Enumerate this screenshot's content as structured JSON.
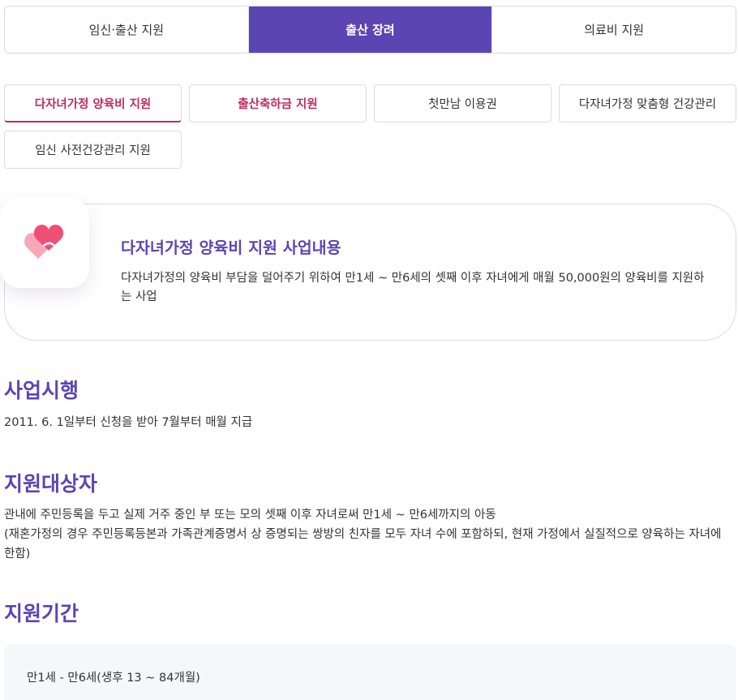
{
  "top_tabs": [
    {
      "label": "임신·출산 지원"
    },
    {
      "label": "출산 장려"
    },
    {
      "label": "의료비 지원"
    }
  ],
  "sub_tabs": [
    {
      "label": "다자녀가정 양육비 지원"
    },
    {
      "label": "출산축하금 지원"
    },
    {
      "label": "첫만남 이용권"
    },
    {
      "label": "다자녀가정 맞춤형 건강관리"
    },
    {
      "label": "임신 사전건강관리 지원"
    }
  ],
  "intro": {
    "icon": "heart-icon",
    "title": "다자녀가정 양육비 지원 사업내용",
    "description": "다자녀가정의 양육비 부담을 덜어주기 위하여 만1세 ~ 만6세의 셋째 이후 자녀에게 매월 50,000원의 양육비를 지원하는 사업"
  },
  "sections": {
    "start": {
      "title": "사업시행",
      "text": "2011. 6. 1일부터 신청을 받아 7월부터 매월 지급"
    },
    "target": {
      "title": "지원대상자",
      "line1": "관내에 주민등록을 두고 실제 거주 중인 부 또는 모의 셋째 이후 자녀로써 만1세 ~ 만6세까지의 아동",
      "line2": "(재혼가정의 경우 주민등록등본과 가족관계증명서 상 증명되는 쌍방의 친자를 모두 자녀 수에 포함하되, 현재 가정에서 실질적으로 양육하는 자녀에 한함)"
    },
    "period": {
      "title": "지원기간",
      "text": "만1세 - 만6세(생후 13 ~ 84개월)"
    }
  },
  "colors": {
    "accent": "#5b45b3",
    "highlight": "#c02a5c",
    "heart_light": "#f7a8b8",
    "heart_dark": "#ef4f74"
  }
}
